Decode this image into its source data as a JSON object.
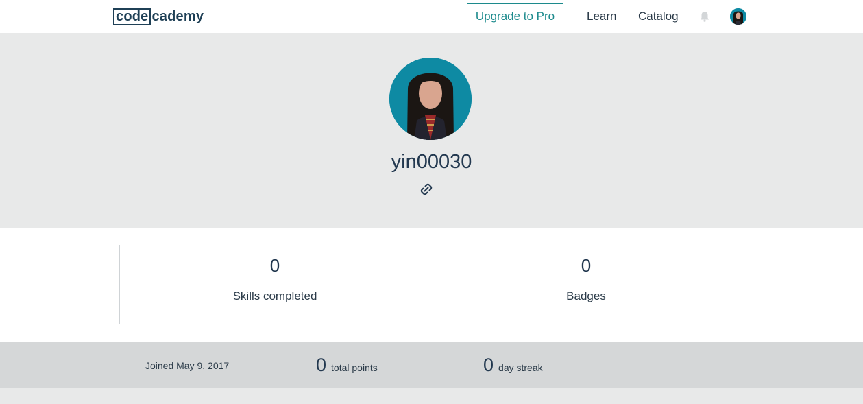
{
  "header": {
    "logo_boxed": "code",
    "logo_rest": "cademy",
    "upgrade_label": "Upgrade to Pro",
    "nav": {
      "learn": "Learn",
      "catalog": "Catalog"
    },
    "icons": {
      "notifications": "bell-icon",
      "account": "avatar"
    }
  },
  "profile": {
    "username": "yin00030",
    "link_icon": "link-icon"
  },
  "stats": {
    "skills": {
      "value": "0",
      "label": "Skills completed"
    },
    "badges": {
      "value": "0",
      "label": "Badges"
    }
  },
  "summary": {
    "joined": "Joined May 9, 2017",
    "points": {
      "value": "0",
      "label": "total points"
    },
    "streak": {
      "value": "0",
      "label": "day streak"
    }
  },
  "colors": {
    "brand_teal": "#1c8a8c",
    "navy": "#1f4056",
    "hero_bg": "#e8e9e9",
    "summary_bg": "#d5d7d8"
  }
}
